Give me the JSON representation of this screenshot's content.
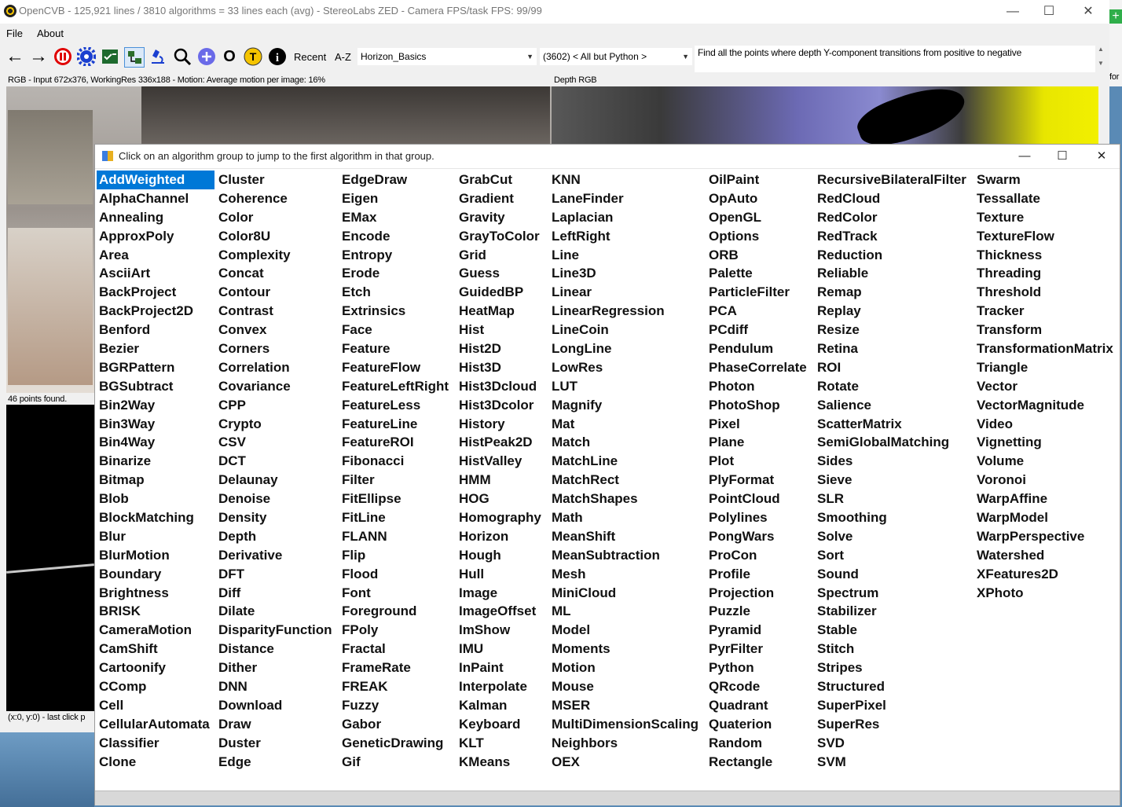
{
  "window": {
    "title": "OpenCVB - 125,921 lines / 3810 algorithms = 33 lines each (avg) - StereoLabs ZED - Camera FPS/task FPS: 99/99"
  },
  "menu": {
    "items": [
      "File",
      "About"
    ]
  },
  "toolbar": {
    "recent_label": "Recent",
    "az_label": "A-Z",
    "algorithm_select": "Horizon_Basics",
    "group_select": "(3602) < All but Python >",
    "description": "Find all the points where depth Y-component transitions from positive to negative"
  },
  "status": {
    "rgb_caption": "RGB - Input 672x376, WorkingRes 336x188 - Motion:  Average motion per image: 16%",
    "depth_caption": "Depth RGB",
    "points_found": "46 points found.",
    "last_click": "(x:0, y:0) - last click p",
    "right_edge": "for"
  },
  "dialog": {
    "title": "Click on an algorithm group to jump to the first algorithm in that group.",
    "selected": "AddWeighted",
    "columns": [
      [
        "AddWeighted",
        "AlphaChannel",
        "Annealing",
        "ApproxPoly",
        "Area",
        "AsciiArt",
        "BackProject",
        "BackProject2D",
        "Benford",
        "Bezier",
        "BGRPattern",
        "BGSubtract",
        "Bin2Way",
        "Bin3Way",
        "Bin4Way",
        "Binarize",
        "Bitmap",
        "Blob",
        "BlockMatching",
        "Blur",
        "BlurMotion",
        "Boundary",
        "Brightness",
        "BRISK",
        "CameraMotion",
        "CamShift",
        "Cartoonify",
        "CComp",
        "Cell",
        "CellularAutomata",
        "Classifier",
        "Clone"
      ],
      [
        "Cluster",
        "Coherence",
        "Color",
        "Color8U",
        "Complexity",
        "Concat",
        "Contour",
        "Contrast",
        "Convex",
        "Corners",
        "Correlation",
        "Covariance",
        "CPP",
        "Crypto",
        "CSV",
        "DCT",
        "Delaunay",
        "Denoise",
        "Density",
        "Depth",
        "Derivative",
        "DFT",
        "Diff",
        "Dilate",
        "DisparityFunction",
        "Distance",
        "Dither",
        "DNN",
        "Download",
        "Draw",
        "Duster",
        "Edge"
      ],
      [
        "EdgeDraw",
        "Eigen",
        "EMax",
        "Encode",
        "Entropy",
        "Erode",
        "Etch",
        "Extrinsics",
        "Face",
        "Feature",
        "FeatureFlow",
        "FeatureLeftRight",
        "FeatureLess",
        "FeatureLine",
        "FeatureROI",
        "Fibonacci",
        "Filter",
        "FitEllipse",
        "FitLine",
        "FLANN",
        "Flip",
        "Flood",
        "Font",
        "Foreground",
        "FPoly",
        "Fractal",
        "FrameRate",
        "FREAK",
        "Fuzzy",
        "Gabor",
        "GeneticDrawing",
        "Gif"
      ],
      [
        "GrabCut",
        "Gradient",
        "Gravity",
        "GrayToColor",
        "Grid",
        "Guess",
        "GuidedBP",
        "HeatMap",
        "Hist",
        "Hist2D",
        "Hist3D",
        "Hist3Dcloud",
        "Hist3Dcolor",
        "History",
        "HistPeak2D",
        "HistValley",
        "HMM",
        "HOG",
        "Homography",
        "Horizon",
        "Hough",
        "Hull",
        "Image",
        "ImageOffset",
        "ImShow",
        "IMU",
        "InPaint",
        "Interpolate",
        "Kalman",
        "Keyboard",
        "KLT",
        "KMeans"
      ],
      [
        "KNN",
        "LaneFinder",
        "Laplacian",
        "LeftRight",
        "Line",
        "Line3D",
        "Linear",
        "LinearRegression",
        "LineCoin",
        "LongLine",
        "LowRes",
        "LUT",
        "Magnify",
        "Mat",
        "Match",
        "MatchLine",
        "MatchRect",
        "MatchShapes",
        "Math",
        "MeanShift",
        "MeanSubtraction",
        "Mesh",
        "MiniCloud",
        "ML",
        "Model",
        "Moments",
        "Motion",
        "Mouse",
        "MSER",
        "MultiDimensionScaling",
        "Neighbors",
        "OEX"
      ],
      [
        "OilPaint",
        "OpAuto",
        "OpenGL",
        "Options",
        "ORB",
        "Palette",
        "ParticleFilter",
        "PCA",
        "PCdiff",
        "Pendulum",
        "PhaseCorrelate",
        "Photon",
        "PhotoShop",
        "Pixel",
        "Plane",
        "Plot",
        "PlyFormat",
        "PointCloud",
        "Polylines",
        "PongWars",
        "ProCon",
        "Profile",
        "Projection",
        "Puzzle",
        "Pyramid",
        "PyrFilter",
        "Python",
        "QRcode",
        "Quadrant",
        "Quaterion",
        "Random",
        "Rectangle"
      ],
      [
        "RecursiveBilateralFilter",
        "RedCloud",
        "RedColor",
        "RedTrack",
        "Reduction",
        "Reliable",
        "Remap",
        "Replay",
        "Resize",
        "Retina",
        "ROI",
        "Rotate",
        "Salience",
        "ScatterMatrix",
        "SemiGlobalMatching",
        "Sides",
        "Sieve",
        "SLR",
        "Smoothing",
        "Solve",
        "Sort",
        "Sound",
        "Spectrum",
        "Stabilizer",
        "Stable",
        "Stitch",
        "Stripes",
        "Structured",
        "SuperPixel",
        "SuperRes",
        "SVD",
        "SVM"
      ],
      [
        "Swarm",
        "Tessallate",
        "Texture",
        "TextureFlow",
        "Thickness",
        "Threading",
        "Threshold",
        "Tracker",
        "Transform",
        "TransformationMatrix",
        "Triangle",
        "Vector",
        "VectorMagnitude",
        "Video",
        "Vignetting",
        "Volume",
        "Voronoi",
        "WarpAffine",
        "WarpModel",
        "WarpPerspective",
        "Watershed",
        "XFeatures2D",
        "XPhoto"
      ]
    ]
  },
  "colors": {
    "selection": "#0078d7",
    "stop_red": "#e00000",
    "gear_blue": "#1a3fd0"
  }
}
